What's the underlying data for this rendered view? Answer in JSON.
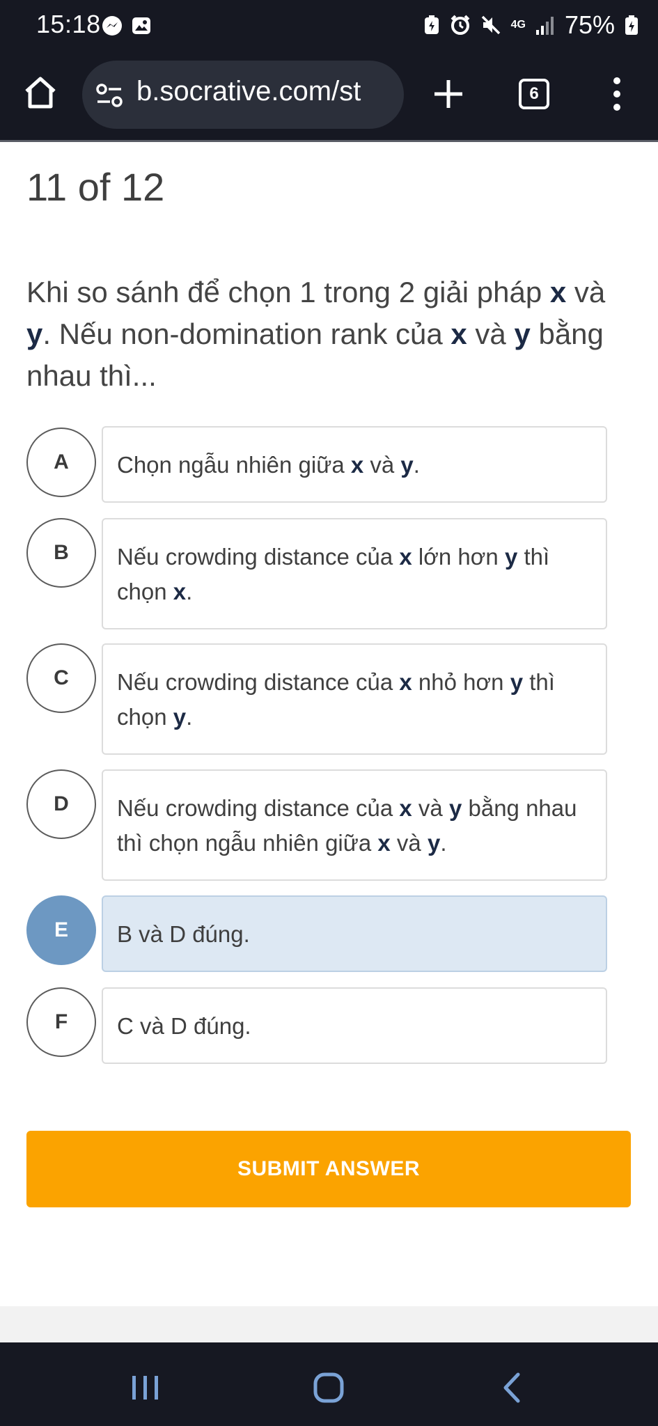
{
  "status_bar": {
    "time": "15:18",
    "network": "4G",
    "battery": "75%"
  },
  "browser": {
    "url": "b.socrative.com/st",
    "tab_count": "6"
  },
  "quiz": {
    "progress": "11 of 12",
    "question": {
      "p1": "Khi so sánh để chọn 1 trong 2 giải pháp ",
      "x1": "x",
      "p2": " và ",
      "y1": "y",
      "p3": ". Nếu non-domination rank của ",
      "x2": "x",
      "p4": " và ",
      "y2": "y",
      "p5": " bằng nhau thì..."
    },
    "selected_option": "E",
    "options": [
      {
        "letter": "A",
        "parts": [
          "Chọn ngẫu nhiên giữa ",
          "x",
          " và ",
          "y",
          "."
        ]
      },
      {
        "letter": "B",
        "parts": [
          "Nếu crowding distance của ",
          "x",
          " lớn hơn ",
          "y",
          " thì chọn ",
          "x",
          "."
        ]
      },
      {
        "letter": "C",
        "parts": [
          "Nếu crowding distance của ",
          "x",
          " nhỏ hơn ",
          "y",
          " thì chọn ",
          "y",
          "."
        ]
      },
      {
        "letter": "D",
        "parts": [
          "Nếu crowding distance của ",
          "x",
          " và ",
          "y",
          " bằng nhau thì chọn ngẫu nhiên giữa ",
          "x",
          " và ",
          "y",
          "."
        ]
      },
      {
        "letter": "E",
        "parts": [
          "B và D đúng."
        ]
      },
      {
        "letter": "F",
        "parts": [
          "C và D đúng."
        ]
      }
    ],
    "submit_label": "SUBMIT ANSWER"
  },
  "colors": {
    "system_bar": "#161822",
    "selected_circle": "#6d98c2",
    "selected_box": "#dde8f3",
    "submit_button": "#fba300",
    "emphasis_text": "#1c2a45"
  },
  "icons": {
    "status_left": [
      "messenger-icon",
      "gallery-icon"
    ],
    "status_right": [
      "battery-saver-icon",
      "alarm-icon",
      "mute-icon",
      "signal-icon",
      "battery-icon"
    ],
    "browser": [
      "home-icon",
      "site-settings-icon",
      "plus-icon",
      "tabs-icon",
      "more-vert-icon"
    ],
    "nav": [
      "recents-icon",
      "home-icon",
      "back-icon"
    ]
  }
}
